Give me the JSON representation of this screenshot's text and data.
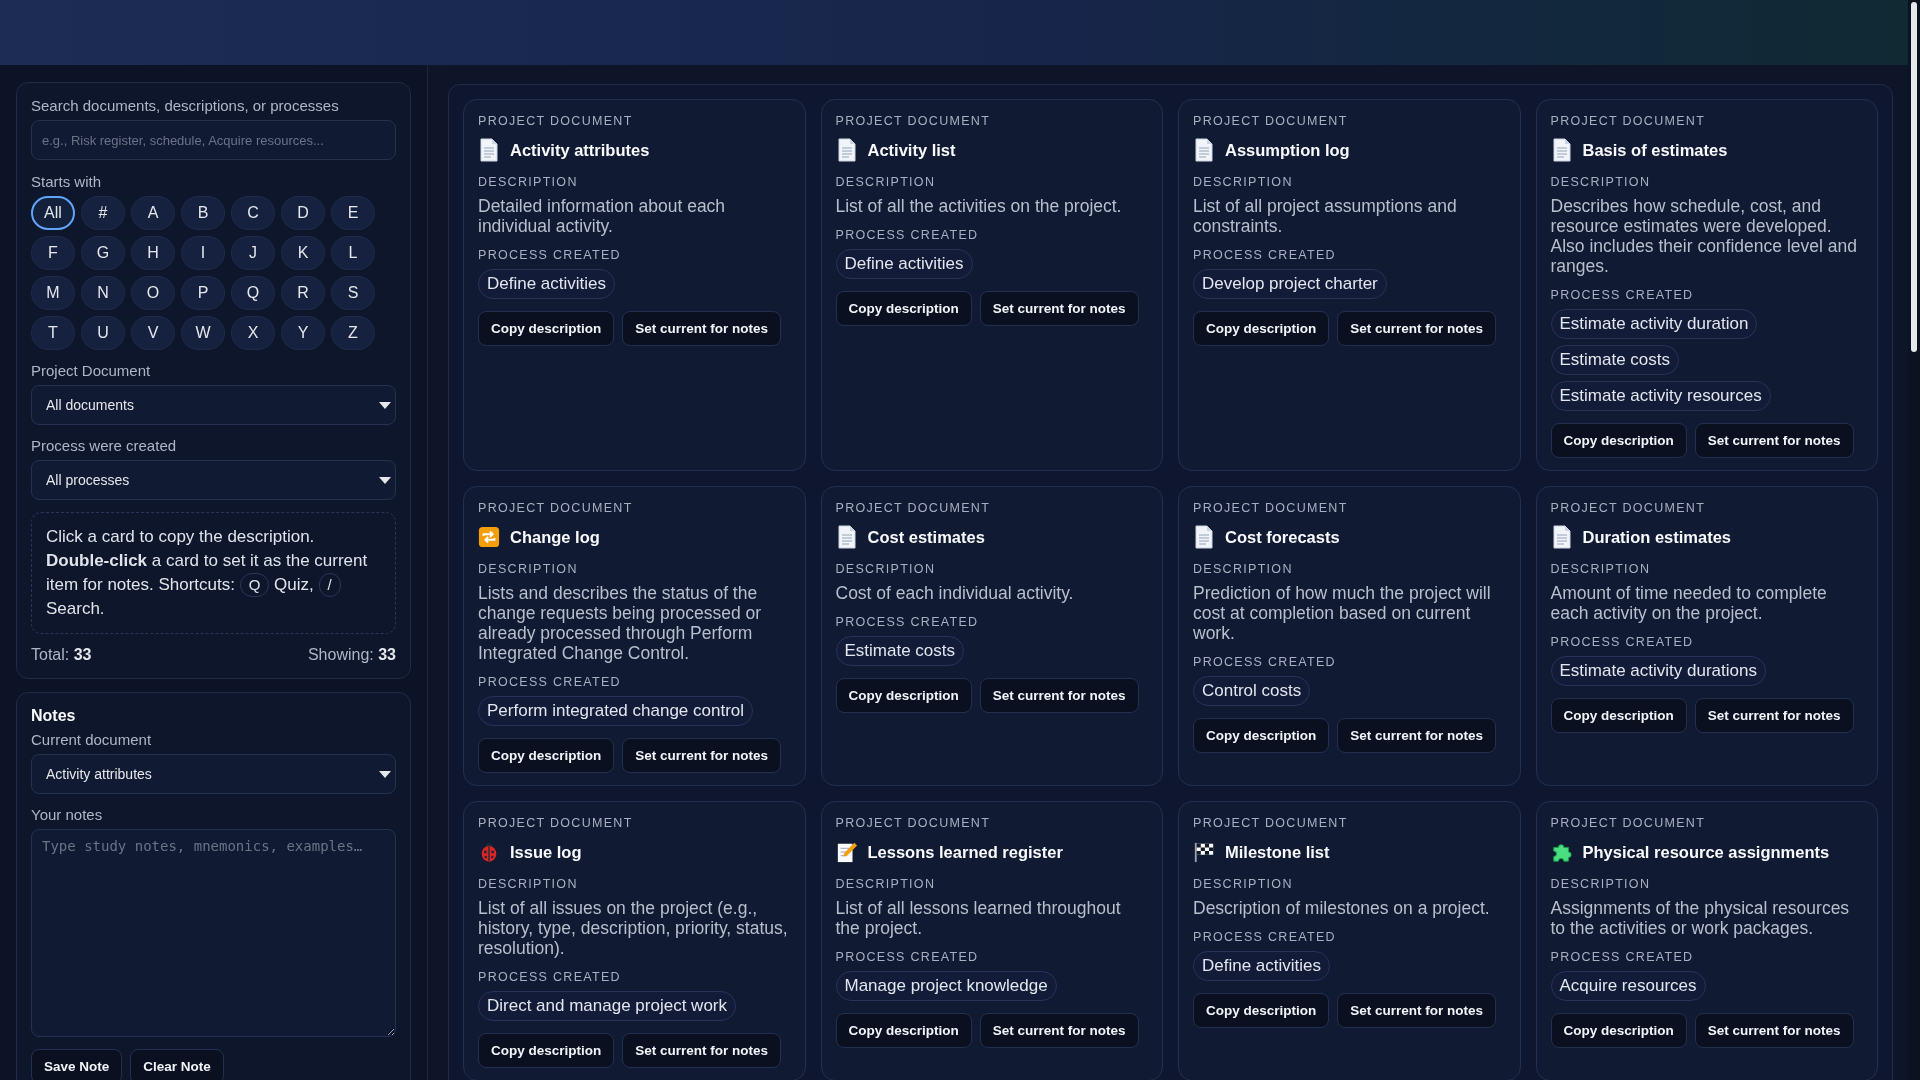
{
  "search": {
    "label": "Search documents, descriptions, or processes",
    "placeholder": "e.g., Risk register, schedule, Acquire resources..."
  },
  "starts_with": {
    "label": "Starts with",
    "letters": [
      {
        "text": "All",
        "selected": true
      },
      {
        "text": "#",
        "selected": false
      },
      {
        "text": "A",
        "selected": false
      },
      {
        "text": "B",
        "selected": false
      },
      {
        "text": "C",
        "selected": false
      },
      {
        "text": "D",
        "selected": false
      },
      {
        "text": "E",
        "selected": false
      },
      {
        "text": "F",
        "selected": false
      },
      {
        "text": "G",
        "selected": false
      },
      {
        "text": "H",
        "selected": false
      },
      {
        "text": "I",
        "selected": false
      },
      {
        "text": "J",
        "selected": false
      },
      {
        "text": "K",
        "selected": false
      },
      {
        "text": "L",
        "selected": false
      },
      {
        "text": "M",
        "selected": false
      },
      {
        "text": "N",
        "selected": false
      },
      {
        "text": "O",
        "selected": false
      },
      {
        "text": "P",
        "selected": false
      },
      {
        "text": "Q",
        "selected": false
      },
      {
        "text": "R",
        "selected": false
      },
      {
        "text": "S",
        "selected": false
      },
      {
        "text": "T",
        "selected": false
      },
      {
        "text": "U",
        "selected": false
      },
      {
        "text": "V",
        "selected": false
      },
      {
        "text": "W",
        "selected": false
      },
      {
        "text": "X",
        "selected": false
      },
      {
        "text": "Y",
        "selected": false
      },
      {
        "text": "Z",
        "selected": false
      }
    ]
  },
  "filters": [
    {
      "label": "Project Document",
      "value": "All documents"
    },
    {
      "label": "Process were created",
      "value": "All processes"
    }
  ],
  "hint": [
    {
      "kind": "text",
      "text": "Click a card to copy the description. **Double-click** a card to set it as the current item for notes. Shortcuts:"
    },
    {
      "kind": "key",
      "text": "Q"
    },
    {
      "kind": "text",
      "text": "Quiz,"
    },
    {
      "kind": "key",
      "text": "/"
    },
    {
      "kind": "text",
      "text": "Search."
    }
  ],
  "total": "Total: **33**",
  "showing": "Showing: **33**",
  "notes": {
    "title": "Notes",
    "current_label": "Current document",
    "current_value": "Activity attributes",
    "notes_label": "Your notes",
    "placeholder": "Type study notes, mnemonics, examples…",
    "buttons": [
      "Save Note",
      "Clear Note"
    ]
  },
  "cards": [
    {
      "kind": "document",
      "eyebrow": "PROJECT DOCUMENT",
      "title": "Activity attributes",
      "description_label": "DESCRIPTION",
      "description": "Detailed information about each individual activity.",
      "process_label": "PROCESS CREATED",
      "processes": [
        "Define activities"
      ],
      "buttons": [
        "Copy description",
        "Set current for notes"
      ]
    },
    {
      "kind": "document",
      "eyebrow": "PROJECT DOCUMENT",
      "title": "Activity list",
      "description_label": "DESCRIPTION",
      "description": "List of all the activities on the project.",
      "process_label": "PROCESS CREATED",
      "processes": [
        "Define activities"
      ],
      "buttons": [
        "Copy description",
        "Set current for notes"
      ]
    },
    {
      "kind": "document",
      "eyebrow": "PROJECT DOCUMENT",
      "title": "Assumption log",
      "description_label": "DESCRIPTION",
      "description": "List of all project assumptions and constraints.",
      "process_label": "PROCESS CREATED",
      "processes": [
        "Develop project charter"
      ],
      "buttons": [
        "Copy description",
        "Set current for notes"
      ]
    },
    {
      "kind": "document",
      "eyebrow": "PROJECT DOCUMENT",
      "title": "Basis of estimates",
      "description_label": "DESCRIPTION",
      "description": "Describes how schedule, cost, and resource estimates were developed. Also includes their confidence level and ranges.",
      "process_label": "PROCESS CREATED",
      "processes": [
        "Estimate activity duration",
        "Estimate costs",
        "Estimate activity resources"
      ],
      "buttons": [
        "Copy description",
        "Set current for notes"
      ]
    },
    {
      "kind": "repeat",
      "eyebrow": "PROJECT DOCUMENT",
      "title": "Change log",
      "description_label": "DESCRIPTION",
      "description": "Lists and describes the status of the change requests being processed or already processed through Perform Integrated Change Control.",
      "process_label": "PROCESS CREATED",
      "processes": [
        "Perform integrated change control"
      ],
      "buttons": [
        "Copy description",
        "Set current for notes"
      ]
    },
    {
      "kind": "document",
      "eyebrow": "PROJECT DOCUMENT",
      "title": "Cost estimates",
      "description_label": "DESCRIPTION",
      "description": "Cost of each individual activity.",
      "process_label": "PROCESS CREATED",
      "processes": [
        "Estimate costs"
      ],
      "buttons": [
        "Copy description",
        "Set current for notes"
      ]
    },
    {
      "kind": "document",
      "eyebrow": "PROJECT DOCUMENT",
      "title": "Cost forecasts",
      "description_label": "DESCRIPTION",
      "description": "Prediction of how much the project will cost at completion based on current work.",
      "process_label": "PROCESS CREATED",
      "processes": [
        "Control costs"
      ],
      "buttons": [
        "Copy description",
        "Set current for notes"
      ]
    },
    {
      "kind": "document",
      "eyebrow": "PROJECT DOCUMENT",
      "title": "Duration estimates",
      "description_label": "DESCRIPTION",
      "description": "Amount of time needed to complete each activity on the project.",
      "process_label": "PROCESS CREATED",
      "processes": [
        "Estimate activity durations"
      ],
      "buttons": [
        "Copy description",
        "Set current for notes"
      ]
    },
    {
      "kind": "bug",
      "eyebrow": "PROJECT DOCUMENT",
      "title": "Issue log",
      "description_label": "DESCRIPTION",
      "description": "List of all issues on the project (e.g., history, type, description, priority, status, resolution).",
      "process_label": "PROCESS CREATED",
      "processes": [
        "Direct and manage project work"
      ],
      "buttons": [
        "Copy description",
        "Set current for notes"
      ]
    },
    {
      "kind": "memo",
      "eyebrow": "PROJECT DOCUMENT",
      "title": "Lessons learned register",
      "description_label": "DESCRIPTION",
      "description": "List of all lessons learned throughout the project.",
      "process_label": "PROCESS CREATED",
      "processes": [
        "Manage project knowledge"
      ],
      "buttons": [
        "Copy description",
        "Set current for notes"
      ]
    },
    {
      "kind": "flag",
      "eyebrow": "PROJECT DOCUMENT",
      "title": "Milestone list",
      "description_label": "DESCRIPTION",
      "description": "Description of milestones on a project.",
      "process_label": "PROCESS CREATED",
      "processes": [
        "Define activities"
      ],
      "buttons": [
        "Copy description",
        "Set current for notes"
      ]
    },
    {
      "kind": "puzzle",
      "eyebrow": "PROJECT DOCUMENT",
      "title": "Physical resource assignments",
      "description_label": "DESCRIPTION",
      "description": "Assignments of the physical resources to the activities or work packages.",
      "process_label": "PROCESS CREATED",
      "processes": [
        "Acquire resources"
      ],
      "buttons": [
        "Copy description",
        "Set current for notes"
      ]
    }
  ]
}
